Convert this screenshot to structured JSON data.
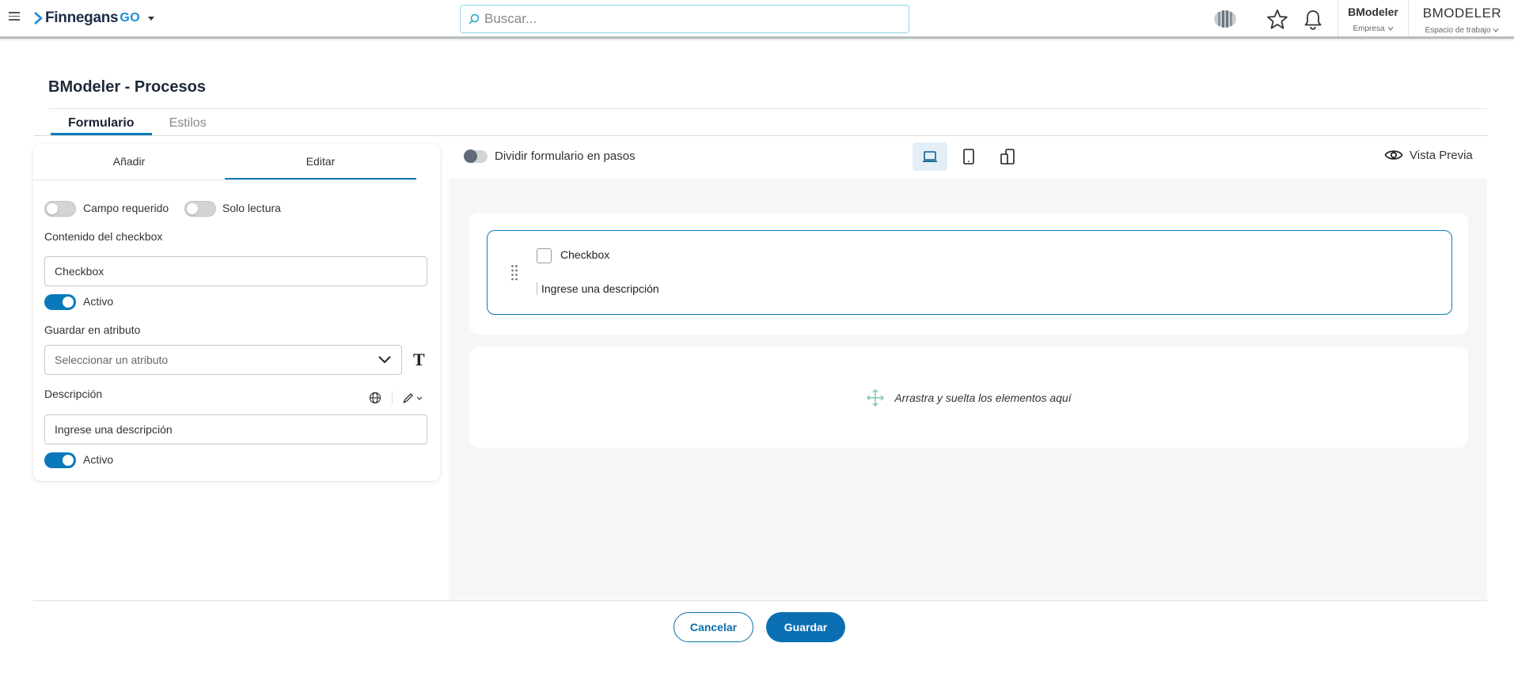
{
  "header": {
    "logo_text": "Finnegans",
    "logo_suffix": "GO",
    "search_placeholder": "Buscar...",
    "company_name": "BModeler",
    "company_label": "Empresa",
    "workspace_name": "BMODELER",
    "workspace_label": "Espacio de trabajo"
  },
  "page": {
    "title": "BModeler - Procesos",
    "tabs": [
      "Formulario",
      "Estilos"
    ]
  },
  "left_panel": {
    "tabs": [
      "Añadir",
      "Editar"
    ],
    "required_label": "Campo requerido",
    "readonly_label": "Solo lectura",
    "checkbox_content_label": "Contenido del checkbox",
    "checkbox_content_value": "Checkbox",
    "active_label_1": "Activo",
    "save_attr_label": "Guardar en atributo",
    "attr_placeholder": "Seleccionar un atributo",
    "type_glyph": "T",
    "description_label": "Descripción",
    "description_value": "Ingrese una descripción",
    "active_label_2": "Activo"
  },
  "toolbar": {
    "split_steps_label": "Dividir formulario en pasos",
    "preview_label": "Vista Previa"
  },
  "canvas": {
    "checkbox_label": "Checkbox",
    "description": "Ingrese una descripción",
    "drop_text": "Arrastra y suelta los elementos aquí"
  },
  "footer": {
    "cancel_label": "Cancelar",
    "save_label": "Guardar"
  },
  "colors": {
    "accent": "#0a7cbf",
    "primary_button": "#0a6fb2",
    "search_border": "#8fd6e6",
    "canvas_bg": "#f6f6f6"
  }
}
